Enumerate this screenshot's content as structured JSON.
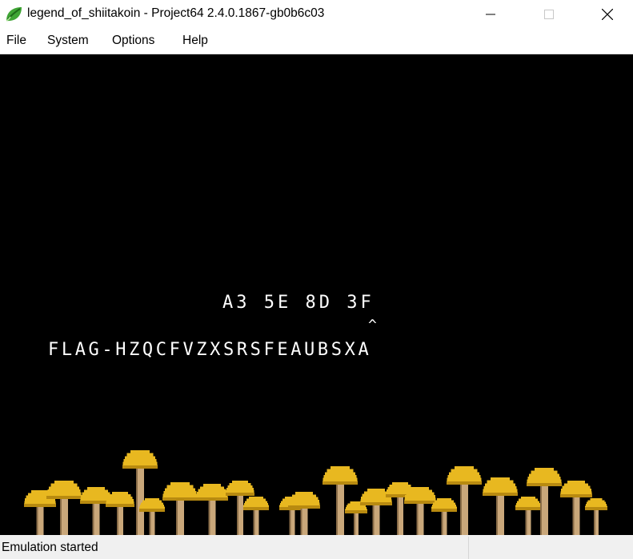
{
  "window": {
    "title": "legend_of_shiitakoin - Project64 2.4.0.1867-gb0b6c03",
    "icon": "project64-leaf-icon",
    "controls": [
      "minimize-icon",
      "maximize-icon",
      "close-icon"
    ]
  },
  "menu": {
    "file": "File",
    "system": "System",
    "options": "Options",
    "help": "Help"
  },
  "game": {
    "code_row": "A3 5E 8D 3F",
    "caret": "^",
    "flag_row": "FLAG-HZQCFVZXSRSFEAUBSXA",
    "scenery": "mushroom-forest",
    "colors": {
      "background": "#000000",
      "text": "#ffffff",
      "cap": "#e8b820",
      "cap_shadow": "#b88a10",
      "stem": "#c9a77a"
    }
  },
  "status": {
    "text": "Emulation started"
  }
}
